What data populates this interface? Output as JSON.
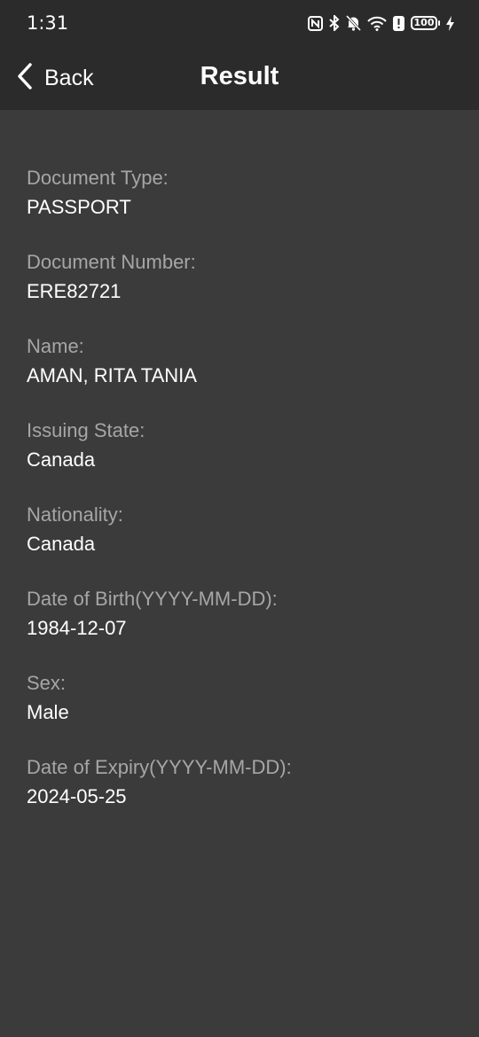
{
  "status": {
    "time": "1:31",
    "battery": "100",
    "icons": [
      "nfc-icon",
      "bluetooth-icon",
      "bell-muted-icon",
      "wifi-icon",
      "notification-badge-icon",
      "battery-icon",
      "charging-icon"
    ]
  },
  "nav": {
    "back_label": "Back",
    "title": "Result"
  },
  "fields": [
    {
      "label": "Document Type:",
      "value": "PASSPORT"
    },
    {
      "label": "Document Number:",
      "value": "ERE82721"
    },
    {
      "label": "Name:",
      "value": "AMAN, RITA TANIA"
    },
    {
      "label": "Issuing State:",
      "value": "Canada"
    },
    {
      "label": "Nationality:",
      "value": "Canada"
    },
    {
      "label": "Date of Birth(YYYY-MM-DD):",
      "value": "1984-12-07"
    },
    {
      "label": "Sex:",
      "value": "Male"
    },
    {
      "label": "Date of Expiry(YYYY-MM-DD):",
      "value": "2024-05-25"
    }
  ],
  "colors": {
    "background": "#3b3b3b",
    "header": "#2b2b2b",
    "label": "#a6a6a6",
    "value": "#ffffff"
  }
}
